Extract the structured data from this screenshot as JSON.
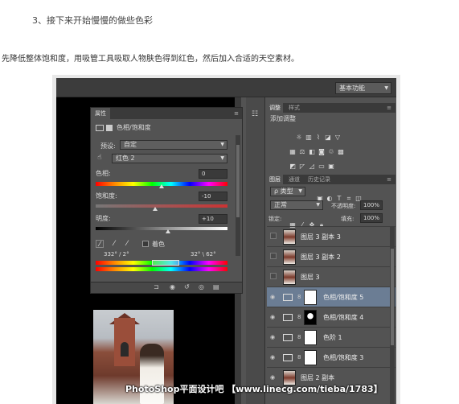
{
  "article": {
    "step_title": "3、接下来开始慢慢的做些色彩",
    "intro": "先降低整体饱和度，用吸管工具吸取人物肤色得到红色，然后加入合适的天空素材。"
  },
  "app": {
    "workspace": "基本功能"
  },
  "properties_panel": {
    "tab": "属性",
    "adj_name": "色相/饱和度",
    "preset_label": "预设:",
    "preset_value": "自定",
    "channel_value": "红色 2",
    "hue_label": "色相:",
    "hue_value": "0",
    "hue_knob": 0.5,
    "saturation_label": "饱和度:",
    "saturation_value": "-10",
    "saturation_knob": 0.45,
    "lightness_label": "明度:",
    "lightness_value": "+10",
    "lightness_knob": 0.55,
    "colorize_label": "着色",
    "range_left": "332° / 2°",
    "range_right": "32° \\ 62°"
  },
  "adjustments_panel": {
    "tab_adjust": "调整",
    "tab_style": "样式",
    "add_label": "添加调整"
  },
  "layers_panel": {
    "tab_layers": "图层",
    "tab_channels": "通道",
    "tab_history": "历史记录",
    "filter_value": "类型",
    "blend_mode": "正常",
    "opacity_label": "不透明度:",
    "opacity_value": "100%",
    "lock_label": "锁定:",
    "fill_label": "填充:",
    "fill_value": "100%",
    "layers": [
      {
        "name": "图层 3 副本 3",
        "kind": "pixel",
        "visible": false,
        "selected": false
      },
      {
        "name": "图层 3 副本 2",
        "kind": "pixel",
        "visible": false,
        "selected": false
      },
      {
        "name": "图层 3",
        "kind": "pixel",
        "visible": false,
        "selected": false
      },
      {
        "name": "色相/饱和度 5",
        "kind": "adjustment",
        "visible": true,
        "selected": true
      },
      {
        "name": "色相/饱和度 4",
        "kind": "adjustment",
        "visible": true,
        "selected": false
      },
      {
        "name": "色阶 1",
        "kind": "adjustment",
        "visible": true,
        "selected": false
      },
      {
        "name": "色相/饱和度 3",
        "kind": "adjustment",
        "visible": true,
        "selected": false
      },
      {
        "name": "图层 2 副本",
        "kind": "pixel",
        "visible": true,
        "selected": false
      }
    ]
  },
  "watermark": "PhotoShop平面设计吧 【www.linecg.com/tieba/1783】"
}
